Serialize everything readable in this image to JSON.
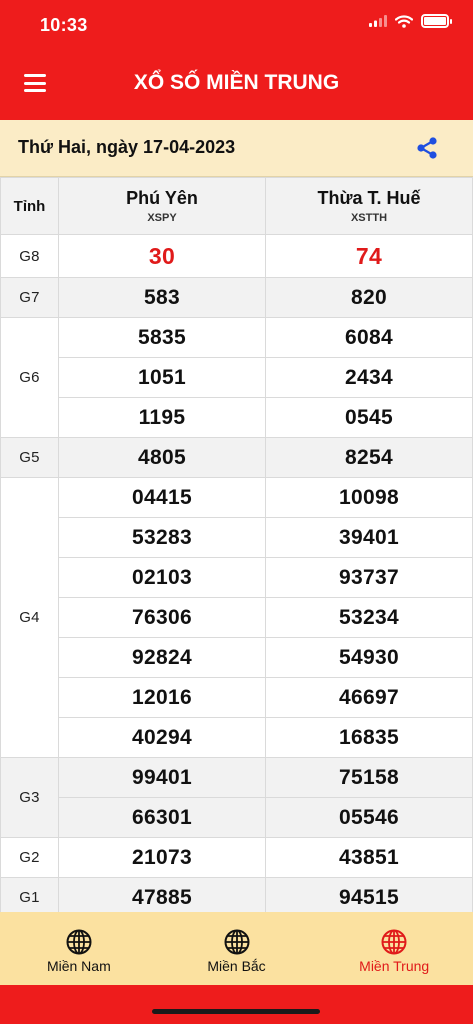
{
  "status_bar": {
    "time": "10:33"
  },
  "header": {
    "title": "XỔ SỐ MIỀN TRUNG"
  },
  "date_bar": {
    "text": "Thứ Hai, ngày 17-04-2023"
  },
  "table": {
    "label_header": "Tỉnh",
    "provinces": [
      {
        "name": "Phú Yên",
        "code": "XSPY"
      },
      {
        "name": "Thừa T. Huế",
        "code": "XSTTH"
      }
    ],
    "rows": {
      "g8": {
        "label": "G8",
        "values": [
          "30",
          "74"
        ]
      },
      "g7": {
        "label": "G7",
        "values": [
          "583",
          "820"
        ]
      },
      "g6": {
        "label": "G6",
        "values": [
          [
            "5835",
            "6084"
          ],
          [
            "1051",
            "2434"
          ],
          [
            "1195",
            "0545"
          ]
        ]
      },
      "g5": {
        "label": "G5",
        "values": [
          "4805",
          "8254"
        ]
      },
      "g4": {
        "label": "G4",
        "values": [
          [
            "04415",
            "10098"
          ],
          [
            "53283",
            "39401"
          ],
          [
            "02103",
            "93737"
          ],
          [
            "76306",
            "53234"
          ],
          [
            "92824",
            "54930"
          ],
          [
            "12016",
            "46697"
          ],
          [
            "40294",
            "16835"
          ]
        ]
      },
      "g3": {
        "label": "G3",
        "values": [
          [
            "99401",
            "75158"
          ],
          [
            "66301",
            "05546"
          ]
        ]
      },
      "g2": {
        "label": "G2",
        "values": [
          "21073",
          "43851"
        ]
      },
      "g1": {
        "label": "G1",
        "values": [
          "47885",
          "94515"
        ]
      }
    }
  },
  "tabs": [
    {
      "label": "Miền Nam",
      "icon": "globe-icon",
      "active": false
    },
    {
      "label": "Miền Bắc",
      "icon": "globe-icon",
      "active": false
    },
    {
      "label": "Miền Trung",
      "icon": "globe-icon",
      "active": true
    }
  ],
  "colors": {
    "brand_red": "#ee1c1c",
    "accent_red": "#e01a1a",
    "date_bar": "#fbecc6",
    "tab_bar": "#fbe1a0",
    "share_blue": "#1f4fe0"
  }
}
